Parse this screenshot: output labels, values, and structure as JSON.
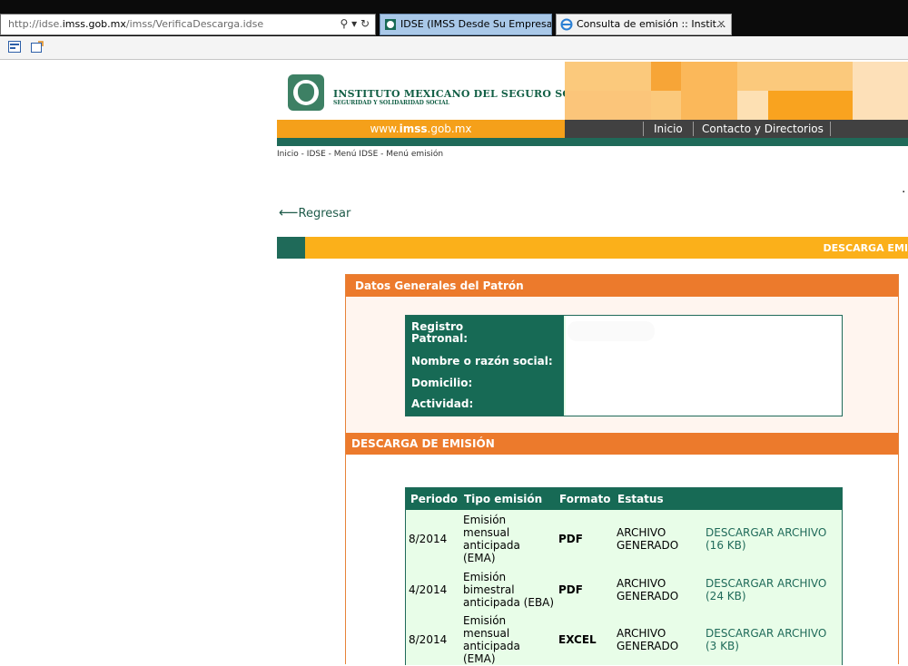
{
  "browser": {
    "address_prefix": "http://idse.",
    "address_domain": "imss.gob.mx",
    "address_path": "/imss/VerificaDescarga.idse",
    "address_controls": "⚲ ▾ ↻",
    "tabs": [
      {
        "label": "IDSE (IMSS Desde Su Empresa)"
      },
      {
        "label": "Consulta de emisión :: Instit...",
        "close": "✕"
      }
    ]
  },
  "header": {
    "institute_name": "INSTITUTO MEXICANO DEL SEGURO SOCIAL",
    "institute_subtitle": "SEGURIDAD Y SOLIDARIDAD SOCIAL",
    "website_prefix": "www.",
    "website_domain": "imss",
    "website_suffix": ".gob.mx",
    "nav": [
      {
        "label": "Inicio"
      },
      {
        "label": "Contacto y Directorios"
      }
    ]
  },
  "breadcrumb": "Inicio - IDSE - Menú IDSE - Menú emisión",
  "back_arrow": "⟵",
  "back_label": "Regresar",
  "stray_char": "․",
  "section_title": "DESCARGA EMI",
  "patron": {
    "header": "Datos Generales del Patrón",
    "labels": [
      {
        "text": "Registro Patronal:"
      },
      {
        "text": "Nombre o razón social:"
      },
      {
        "text": "Domicilio:"
      },
      {
        "text": "Actividad:"
      }
    ]
  },
  "emision": {
    "header": "DESCARGA DE EMISIÓN",
    "columns": [
      "Periodo",
      "Tipo emisión",
      "Formato",
      "Estatus"
    ],
    "rows": [
      {
        "periodo": "8/2014",
        "tipo": "Emisión mensual anticipada (EMA)",
        "formato": "PDF",
        "estatus": "ARCHIVO GENERADO",
        "accion": "DESCARGAR ARCHIVO (16 KB)"
      },
      {
        "periodo": "4/2014",
        "tipo": "Emisión bimestral anticipada (EBA)",
        "formato": "PDF",
        "estatus": "ARCHIVO GENERADO",
        "accion": "DESCARGAR ARCHIVO (24 KB)"
      },
      {
        "periodo": "8/2014",
        "tipo": "Emisión mensual anticipada (EMA)",
        "formato": "EXCEL",
        "estatus": "ARCHIVO GENERADO",
        "accion": "DESCARGAR ARCHIVO (3 KB)"
      }
    ]
  },
  "colors": {
    "imss_green": "#176a55",
    "imss_orange": "#ec7a2c",
    "imss_yellow": "#fbb01a"
  }
}
